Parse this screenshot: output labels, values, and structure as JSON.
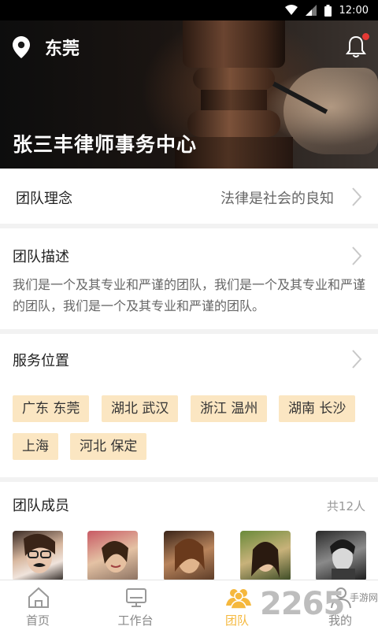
{
  "status_bar": {
    "time": "12:00"
  },
  "header": {
    "city": "东莞",
    "title": "张三丰律师事务中心"
  },
  "team_concept": {
    "label": "团队理念",
    "value": "法律是社会的良知"
  },
  "team_description": {
    "label": "团队描述",
    "text": "我们是一个及其专业和严谨的团队，我们是一个及其专业和严谨的团队，我们是一个及其专业和严谨的团队。"
  },
  "service_locations": {
    "label": "服务位置",
    "tags": [
      "广东 东莞",
      "湖北 武汉",
      "浙江 温州",
      "湖南 长沙",
      "上海",
      "河北 保定"
    ]
  },
  "team_members": {
    "label": "团队成员",
    "count": "共12人"
  },
  "tabbar": {
    "items": [
      {
        "label": "首页",
        "icon": "home-icon"
      },
      {
        "label": "工作台",
        "icon": "monitor-icon"
      },
      {
        "label": "团队",
        "icon": "team-icon",
        "active": true
      },
      {
        "label": "我的",
        "icon": "user-icon"
      }
    ]
  },
  "watermark": {
    "number": "2265",
    "sub": "手游网"
  },
  "colors": {
    "accent": "#f5b83d",
    "tag_bg": "#fbe6c2",
    "notification": "#e53935"
  }
}
